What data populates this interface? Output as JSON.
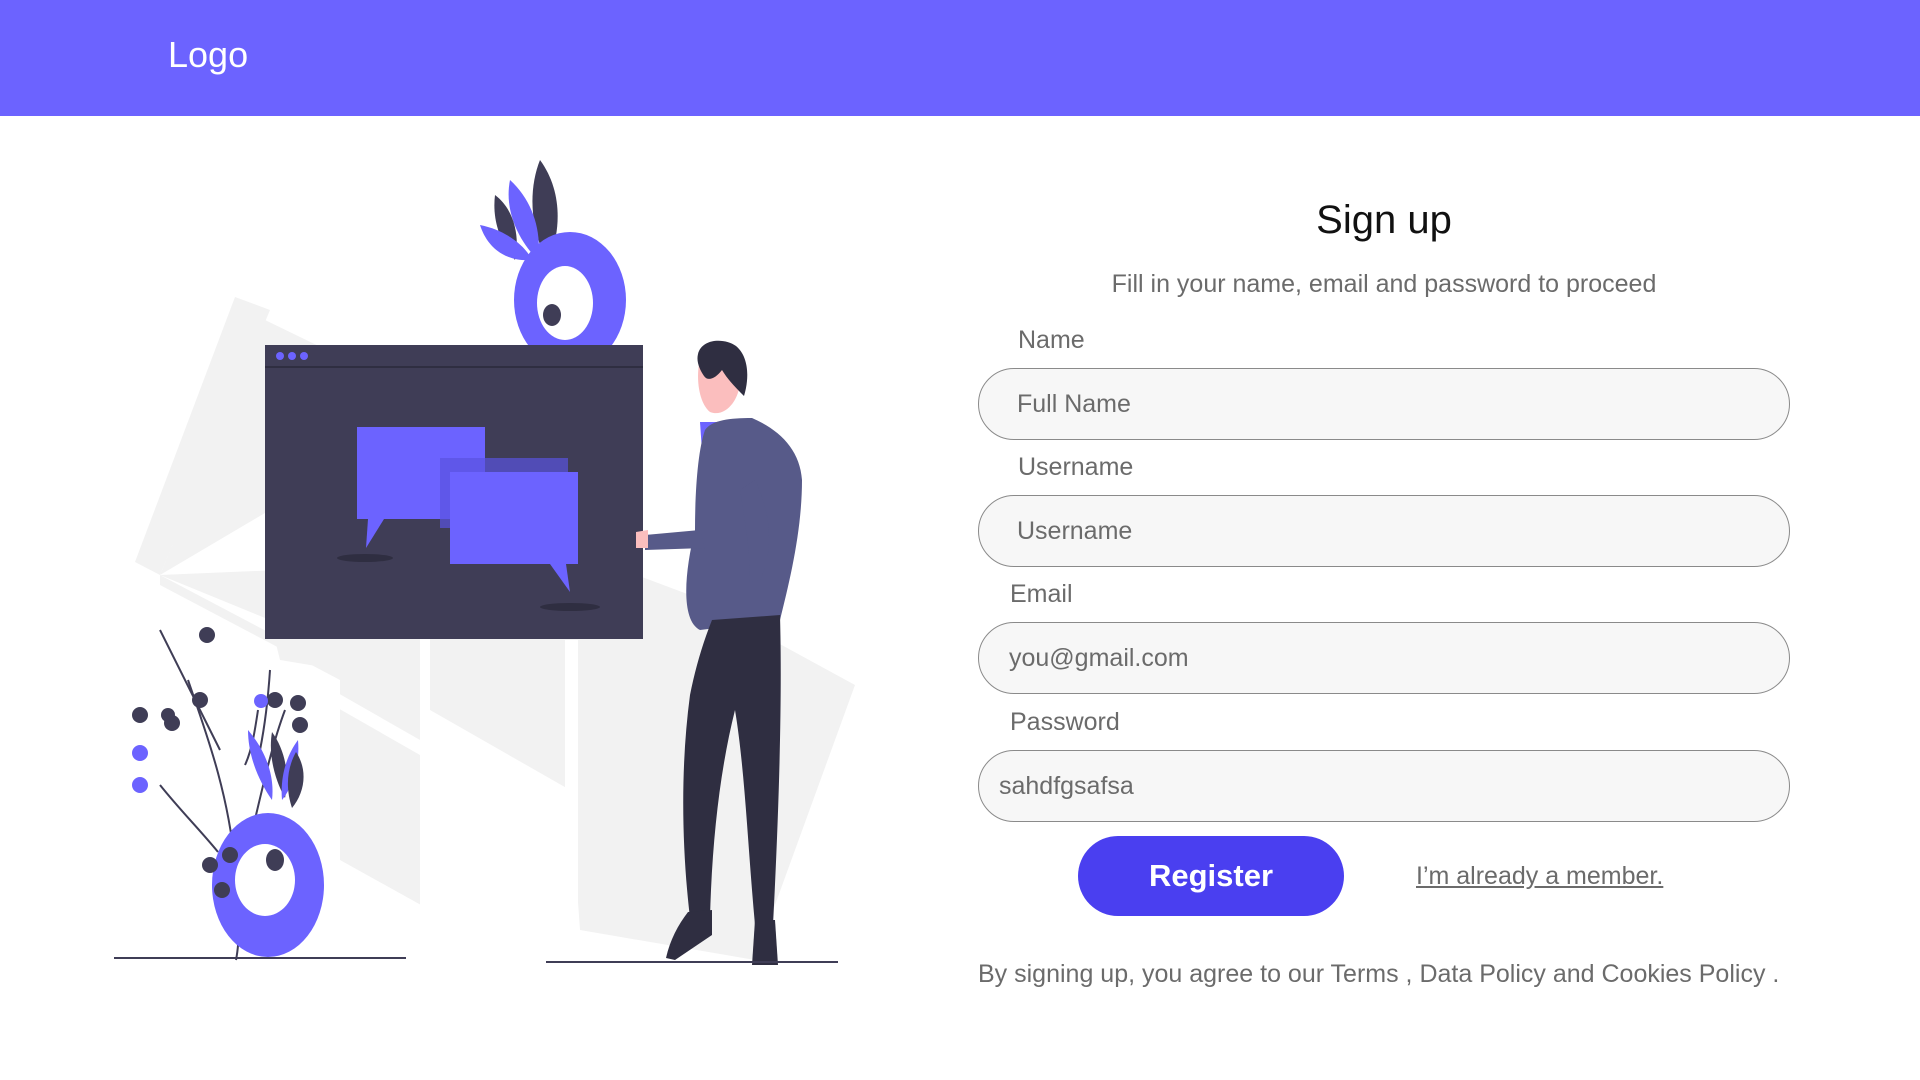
{
  "header": {
    "logo_text": "Logo",
    "background": "#6c63ff"
  },
  "illustration": {
    "description_icon": "person-with-chat-window-illustration",
    "accent": "#6c63ff",
    "dark": "#3f3d56"
  },
  "form": {
    "title": "Sign up",
    "subtitle": "Fill in your name, email and password to proceed",
    "name_label": "Name",
    "name_placeholder": "Full Name",
    "username_label": "Username",
    "username_placeholder": "Username",
    "email_label": "Email",
    "email_placeholder": "you@gmail.com",
    "password_label": "Password",
    "password_value": "sahdfgsafsa",
    "register_label": "Register",
    "member_link": "I’m already a member.",
    "terms_text": "By signing up, you agree to our Terms , Data Policy and Cookies Policy ."
  },
  "colors": {
    "button": "#4a3ff0",
    "field_bg": "#f7f7f7",
    "text_muted": "#6b6b6b"
  }
}
